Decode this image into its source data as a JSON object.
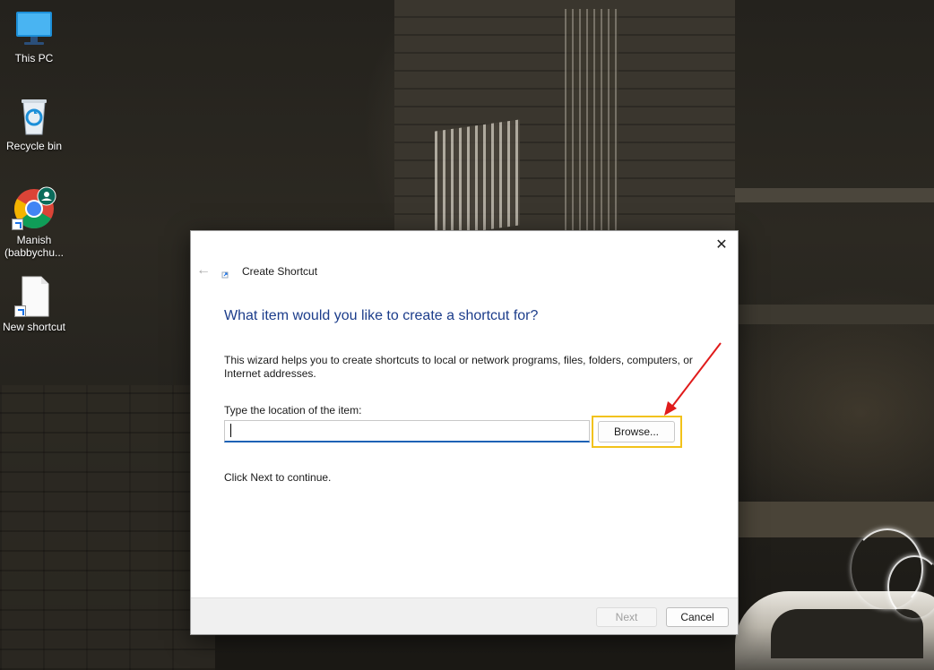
{
  "desktop": {
    "icons": [
      {
        "label": "This PC",
        "icon": "monitor-icon"
      },
      {
        "label": "Recycle bin",
        "icon": "recycle-bin-icon"
      },
      {
        "label": "Manish (babbychu...",
        "icon": "chrome-profile-icon"
      },
      {
        "label": "New shortcut",
        "icon": "blank-file-icon"
      }
    ]
  },
  "dialog": {
    "title": "Create Shortcut",
    "heading": "What item would you like to create a shortcut for?",
    "description": "This wizard helps you to create shortcuts to local or network programs, files, folders, computers, or Internet addresses.",
    "location_label": "Type the location of the item:",
    "location_value": "",
    "browse_label": "Browse...",
    "continue_text": "Click Next to continue.",
    "next_label": "Next",
    "cancel_label": "Cancel",
    "close_glyph": "✕",
    "back_glyph": "←"
  },
  "colors": {
    "heading": "#1c3d8b",
    "highlight": "#f2c21a",
    "annotation_arrow": "#e01b1b",
    "input_underline": "#1d62b5"
  }
}
